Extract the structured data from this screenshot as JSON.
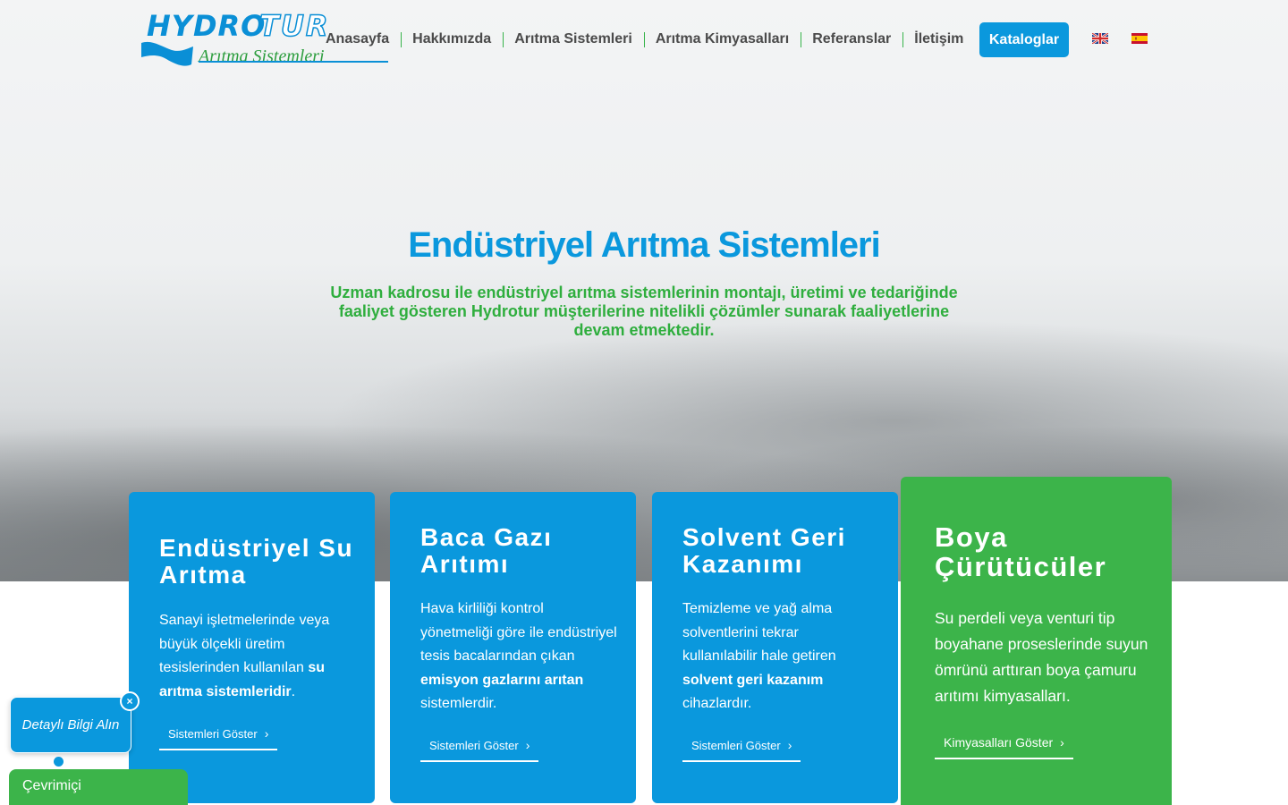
{
  "logo": {
    "text_main": "HYDRO",
    "text_accent": "TUR",
    "subtitle": "Arıtma Sistemleri"
  },
  "nav": {
    "items": [
      "Anasayfa",
      "Hakkımızda",
      "Arıtma Sistemleri",
      "Arıtma Kimyasalları",
      "Referanslar",
      "İletişim"
    ],
    "cta_label": "Kataloglar",
    "languages": [
      "en-flag-icon",
      "es-flag-icon"
    ]
  },
  "hero": {
    "title": "Endüstriyel Arıtma Sistemleri",
    "description": "Uzman kadrosu ile endüstriyel arıtma sistemlerinin montajı, üretimi ve tedariğinde faaliyet gösteren Hydrotur müşterilerine nitelikli çözümler sunarak faaliyetlerine devam etmektedir."
  },
  "cards": [
    {
      "title": "Endüstriyel Su Arıtma",
      "text_plain": "Sanayi işletmelerinde veya büyük ölçekli üretim tesislerinden kullanılan ",
      "text_bold": "su arıtma sistemleridir",
      "text_end": ".",
      "link": "Sistemleri Göster"
    },
    {
      "title": "Baca Gazı Arıtımı",
      "text_plain": "Hava kirliliği kontrol yönetmeliği göre ile endüstriyel tesis bacalarından çıkan ",
      "text_bold": "emisyon gazlarını arıtan",
      "text_end": " sistemlerdir.",
      "link": "Sistemleri Göster"
    },
    {
      "title": "Solvent Geri Kazanımı",
      "text_plain": "Temizleme ve yağ alma solventlerini tekrar kullanılabilir hale getiren ",
      "text_bold": "solvent geri kazanım",
      "text_end": " cihazlardır.",
      "link": "Sistemleri Göster"
    },
    {
      "title": "Boya Çürütücüler",
      "text_plain": "Su perdeli veya venturi tip boyahane proseslerinde suyun ömrünü arttıran boya çamuru arıtımı kimyasalları.",
      "text_bold": "",
      "text_end": "",
      "link": "Kimyasalları Göster"
    }
  ],
  "widgets": {
    "info_bubble": "Detaylı Bilgi Alın",
    "close": "×",
    "online_status": "Çevrimiçi"
  },
  "colors": {
    "brand_blue": "#0a98dd",
    "brand_green": "#3cb44a"
  }
}
